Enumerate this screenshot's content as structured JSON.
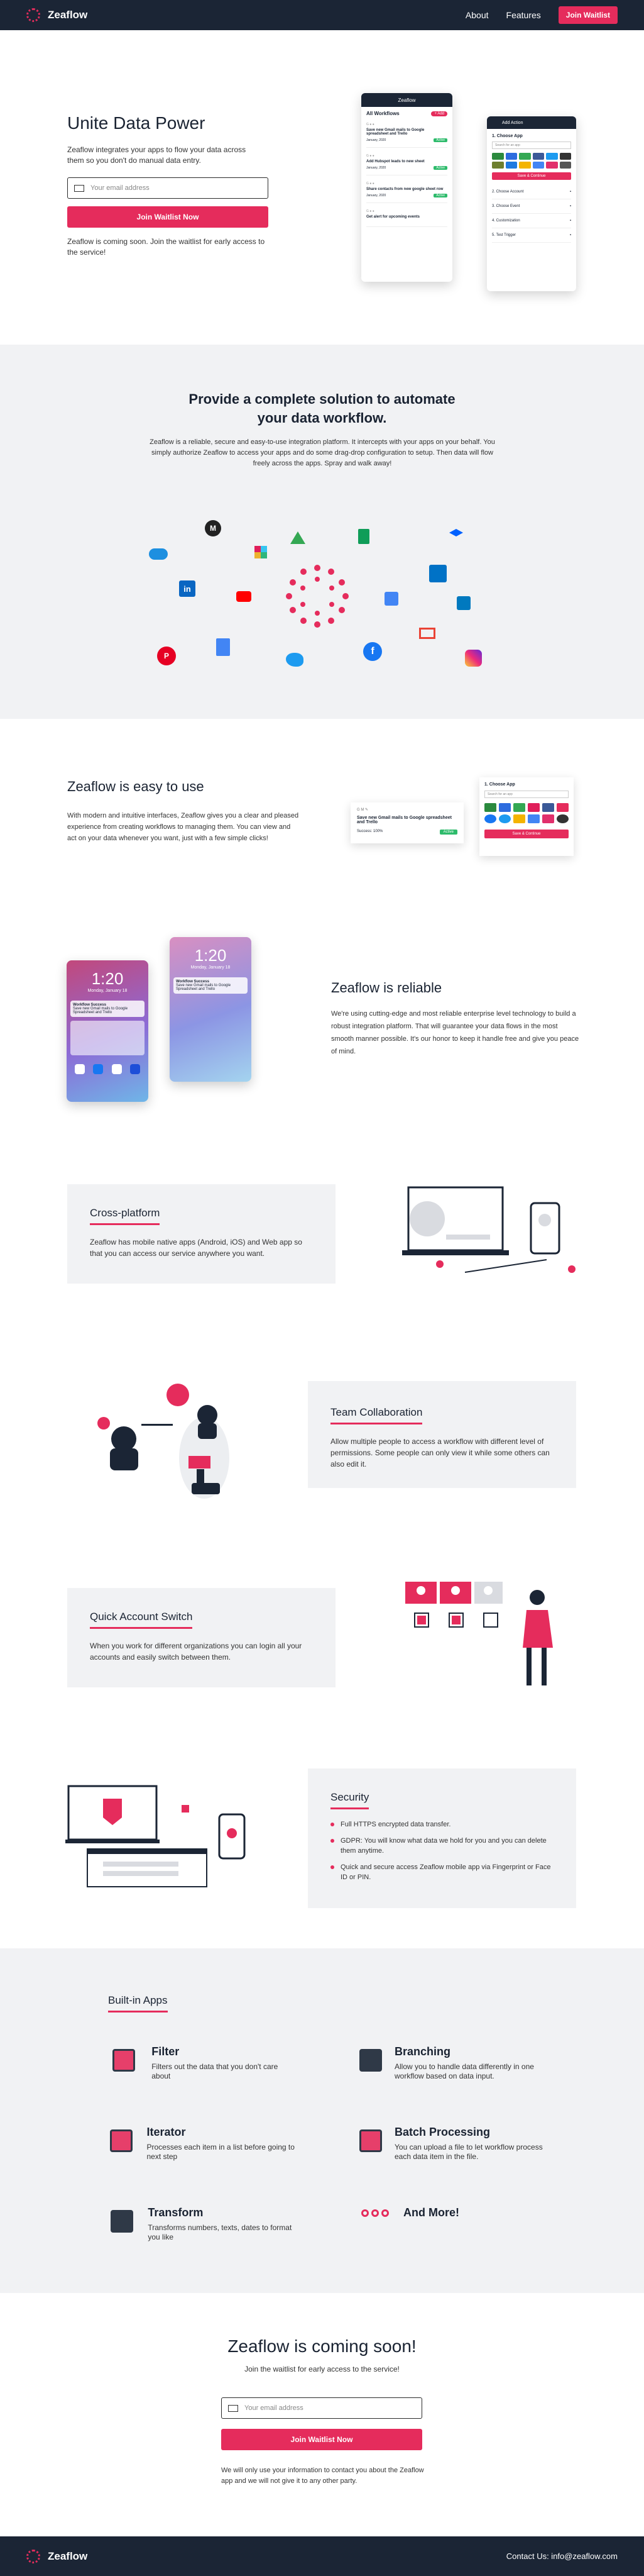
{
  "header": {
    "logo": "Zeaflow",
    "nav_about": "About",
    "nav_features": "Features",
    "join_button": "Join Waitlist"
  },
  "hero": {
    "title": "Unite Data Power",
    "description": "Zeaflow integrates your apps to flow your data across them so you don't do manual data entry.",
    "email_placeholder": "Your email address",
    "join_button": "Join Waitlist Now",
    "note": "Zeaflow is coming soon. Join the waitlist for early access to the service!"
  },
  "phone_workflows": {
    "header": "Zeaflow",
    "title": "All Workflows",
    "badge": "+ Add",
    "items": [
      {
        "title": "Save new Gmail mails to Google spreadsheet and Trello",
        "meta": "January, 2020",
        "status": "Active"
      },
      {
        "title": "Add Hubspot leads to new sheet",
        "meta": "January, 2020",
        "status": "Active"
      },
      {
        "title": "Share contacts from new google sheet row",
        "meta": "January, 2020",
        "status": "Active"
      },
      {
        "title": "Get alert for upcoming events",
        "meta": "",
        "status": ""
      }
    ]
  },
  "phone_addaction": {
    "header": "Add Action",
    "step1": "1. Choose App",
    "search": "Search for an app",
    "button": "Save & Continue",
    "steps": [
      "2. Choose Account",
      "3. Choose Event",
      "4. Customization",
      "5. Test Trigger"
    ]
  },
  "solution": {
    "title": "Provide a complete solution to automate your data workflow.",
    "description": "Zeaflow is a reliable, secure and easy-to-use integration platform. It intercepts with your apps on your behalf. You simply authorize Zeaflow to access your apps and do some drag-drop configuration to setup. Then data will flow freely across the apps. Spray and walk away!"
  },
  "easy": {
    "title": "Zeaflow is easy to use",
    "description": "With modern and intuitive interfaces, Zeaflow gives you a clear and pleased experience from creating workflows to managing them. You can view and act on your data whenever you want, just with a few simple clicks!",
    "card_title": "Save new Gmail mails to Google spreadsheet and Trello",
    "card_meta": "Success: 100%",
    "card_status": "Active",
    "choose_title": "1. Choose App",
    "choose_search": "Search for an app",
    "choose_button": "Save & Continue"
  },
  "reliable": {
    "title": "Zeaflow is reliable",
    "description": "We're using cutting-edge and most reliable enterprise level technology to build a robust integration platform. That will guarantee your data flows in the most smooth manner possible. It's our honor to keep it handle free and give you peace of mind.",
    "phone_time": "1:20",
    "phone_date": "Monday, January 18",
    "notif_app": "Workflow Success",
    "notif_text": "Save new Gmail mails to Google Spreadsheet and Trello"
  },
  "features": [
    {
      "title": "Cross-platform",
      "text": "Zeaflow has mobile native apps (Android, iOS) and Web app so that you can access our service anywhere you want."
    },
    {
      "title": "Team Collaboration",
      "text": "Allow multiple people to access a workflow with different level of permissions. Some people can only view it while some others can also edit it."
    },
    {
      "title": "Quick Account Switch",
      "text": "When you work for different organizations you can login all your accounts and easily switch between them."
    }
  ],
  "security": {
    "title": "Security",
    "items": [
      "Full HTTPS encrypted data transfer.",
      "GDPR: You will know what data we hold for you and you can delete them anytime.",
      "Quick and secure access Zeaflow mobile app via Fingerprint or Face ID or PIN."
    ]
  },
  "builtin": {
    "title": "Built-in Apps",
    "apps": [
      {
        "name": "Filter",
        "text": "Filters out the data that you don't care about",
        "icon": "filter-icon"
      },
      {
        "name": "Branching",
        "text": "Allow you to handle data differently in one workflow based on data input.",
        "icon": "branching-icon"
      },
      {
        "name": "Iterator",
        "text": "Processes each item in a list before going to next step",
        "icon": "iterator-icon"
      },
      {
        "name": "Batch Processing",
        "text": "You can upload a file to let workflow process each data item in the file.",
        "icon": "batch-icon"
      },
      {
        "name": "Transform",
        "text": "Transforms numbers, texts, dates to format you like",
        "icon": "transform-icon"
      },
      {
        "name": "And More!",
        "text": "",
        "icon": "more-icon"
      }
    ]
  },
  "coming": {
    "title": "Zeaflow is coming soon!",
    "subtitle": "Join the waitlist for early access to the service!",
    "email_placeholder": "Your email address",
    "join_button": "Join Waitlist Now",
    "privacy": "We will only use your information to contact you about the Zeaflow app and we will not give it to any other party."
  },
  "footer": {
    "logo": "Zeaflow",
    "contact": "Contact Us: info@zeaflow.com"
  },
  "colors": {
    "accent": "#e52c5c",
    "dark": "#1b2535",
    "band": "#f1f2f4"
  }
}
